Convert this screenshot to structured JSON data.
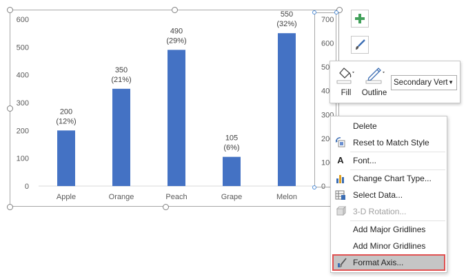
{
  "chart_data": {
    "type": "bar",
    "categories": [
      "Apple",
      "Orange",
      "Peach",
      "Grape",
      "Melon"
    ],
    "values": [
      200,
      350,
      490,
      105,
      550
    ],
    "data_labels": [
      [
        "200",
        "(12%)"
      ],
      [
        "350",
        "(21%)"
      ],
      [
        "490",
        "(29%)"
      ],
      [
        "105",
        "(6%)"
      ],
      [
        "550",
        "(32%)"
      ]
    ],
    "ylim": [
      0,
      600
    ],
    "yticks": [
      "0",
      "100",
      "200",
      "300",
      "400",
      "500",
      "600"
    ],
    "secondary_ylim": [
      0,
      700
    ],
    "secondary_yticks": [
      "0",
      "100",
      "200",
      "300",
      "400",
      "500",
      "600",
      "700"
    ],
    "bar_color": "#4472c4",
    "grid": false,
    "title": "",
    "xlabel": "",
    "ylabel": ""
  },
  "side_buttons": {
    "elements_icon": "plus-icon",
    "styles_icon": "paintbrush-icon"
  },
  "mini_toolbar": {
    "fill_label": "Fill",
    "outline_label": "Outline",
    "element_selector_value": "Secondary Vert"
  },
  "context_menu": {
    "items": [
      {
        "label": "Delete",
        "icon": "",
        "disabled": false
      },
      {
        "label": "Reset to Match Style",
        "icon": "reset-style-icon",
        "disabled": false
      },
      {
        "label": "Font...",
        "icon": "font-icon",
        "disabled": false
      },
      {
        "label": "Change Chart Type...",
        "icon": "chart-type-icon",
        "disabled": false
      },
      {
        "label": "Select Data...",
        "icon": "select-data-icon",
        "disabled": false
      },
      {
        "label": "3-D Rotation...",
        "icon": "rotation-icon",
        "disabled": true
      },
      {
        "label": "Add Major Gridlines",
        "icon": "",
        "disabled": false
      },
      {
        "label": "Add Minor Gridlines",
        "icon": "",
        "disabled": false
      },
      {
        "label": "Format Axis...",
        "icon": "format-axis-icon",
        "disabled": false,
        "highlighted": true
      }
    ],
    "highlight_border_color": "#e05050"
  }
}
